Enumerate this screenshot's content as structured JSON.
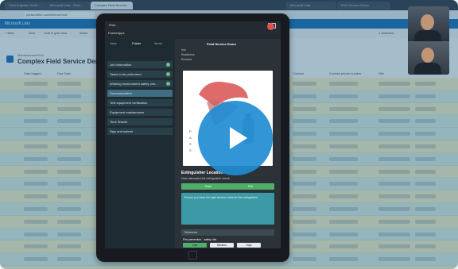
{
  "browser": {
    "tabs": [
      "Field Engineer Work...",
      "Microsoft Lists - Field...",
      "Complex Field Service...",
      "",
      "Microsoft Lists",
      "Field Service Demo"
    ],
    "url": "portal.office.com/field-service"
  },
  "suite": {
    "app_name": "Microsoft Lists"
  },
  "toolbar": {
    "new_label": "+ New",
    "grid_label": "Grid",
    "edit_grid_label": "Edit in grid view",
    "share_label": "Share",
    "selected_label": "1 Selected"
  },
  "list": {
    "breadcrumb": "Maintenance/Field",
    "title": "Complex Field Service Demo"
  },
  "columns": {
    "date_logged": "Date logged",
    "due_date": "Due Date",
    "contact": "Contact",
    "contact_phone": "Contact phone number",
    "site": "Site",
    "job_number": "Job number"
  },
  "tablet": {
    "status": {
      "carrier": "iPad",
      "time": "",
      "battery": ""
    },
    "app": {
      "back_label": "PowerApps",
      "project_title": "Field Service Demo",
      "left_tabs": [
        "Jobs",
        "Folder",
        "Items"
      ],
      "left_items": [
        "Job information",
        "Tasks to be performed",
        "Working environment safety che...",
        "Communication",
        "Test equipment verification",
        "Equipment maintenance",
        "Time Sheets",
        "Sign and submit"
      ],
      "right_header_items": [
        "Info",
        "Readiness",
        "Reviews"
      ],
      "extinguisher_title": "Extinguisher Location",
      "extinguisher_sub": "Have attempted the extinguisher check:",
      "pass_label": "Pass",
      "fail_label": "Fail",
      "note_text": "Ensure you have the right service notes for the extinguisher",
      "section_label": "Reference",
      "fire_label": "Fire prevention - safety risk",
      "btn_low": "Low",
      "btn_medium": "Medium",
      "btn_high": "High"
    }
  },
  "colors": {
    "tint": "#285f82",
    "play": "#1f8cd3",
    "accent_green": "#6fbf8f",
    "lists_blue": "#0f6ab4"
  },
  "icons": [
    "play-icon",
    "home-button-icon",
    "list-icon",
    "battery-icon",
    "camera-icon"
  ]
}
